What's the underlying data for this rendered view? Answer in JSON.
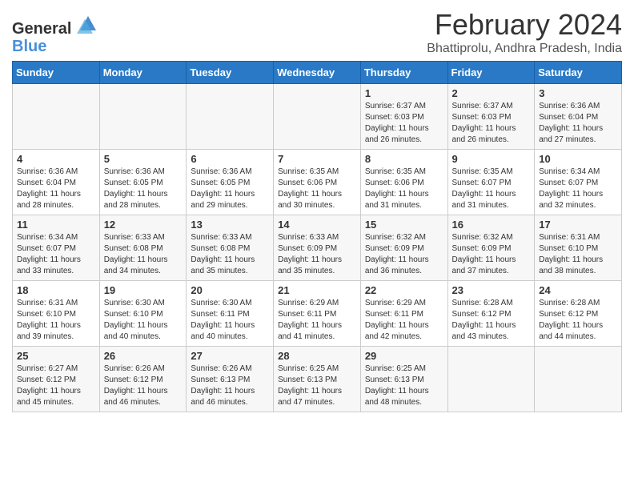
{
  "logo": {
    "text_general": "General",
    "text_blue": "Blue"
  },
  "title": {
    "month_year": "February 2024",
    "location": "Bhattiprolu, Andhra Pradesh, India"
  },
  "headers": [
    "Sunday",
    "Monday",
    "Tuesday",
    "Wednesday",
    "Thursday",
    "Friday",
    "Saturday"
  ],
  "weeks": [
    [
      {
        "day": "",
        "info": ""
      },
      {
        "day": "",
        "info": ""
      },
      {
        "day": "",
        "info": ""
      },
      {
        "day": "",
        "info": ""
      },
      {
        "day": "1",
        "info": "Sunrise: 6:37 AM\nSunset: 6:03 PM\nDaylight: 11 hours\nand 26 minutes."
      },
      {
        "day": "2",
        "info": "Sunrise: 6:37 AM\nSunset: 6:03 PM\nDaylight: 11 hours\nand 26 minutes."
      },
      {
        "day": "3",
        "info": "Sunrise: 6:36 AM\nSunset: 6:04 PM\nDaylight: 11 hours\nand 27 minutes."
      }
    ],
    [
      {
        "day": "4",
        "info": "Sunrise: 6:36 AM\nSunset: 6:04 PM\nDaylight: 11 hours\nand 28 minutes."
      },
      {
        "day": "5",
        "info": "Sunrise: 6:36 AM\nSunset: 6:05 PM\nDaylight: 11 hours\nand 28 minutes."
      },
      {
        "day": "6",
        "info": "Sunrise: 6:36 AM\nSunset: 6:05 PM\nDaylight: 11 hours\nand 29 minutes."
      },
      {
        "day": "7",
        "info": "Sunrise: 6:35 AM\nSunset: 6:06 PM\nDaylight: 11 hours\nand 30 minutes."
      },
      {
        "day": "8",
        "info": "Sunrise: 6:35 AM\nSunset: 6:06 PM\nDaylight: 11 hours\nand 31 minutes."
      },
      {
        "day": "9",
        "info": "Sunrise: 6:35 AM\nSunset: 6:07 PM\nDaylight: 11 hours\nand 31 minutes."
      },
      {
        "day": "10",
        "info": "Sunrise: 6:34 AM\nSunset: 6:07 PM\nDaylight: 11 hours\nand 32 minutes."
      }
    ],
    [
      {
        "day": "11",
        "info": "Sunrise: 6:34 AM\nSunset: 6:07 PM\nDaylight: 11 hours\nand 33 minutes."
      },
      {
        "day": "12",
        "info": "Sunrise: 6:33 AM\nSunset: 6:08 PM\nDaylight: 11 hours\nand 34 minutes."
      },
      {
        "day": "13",
        "info": "Sunrise: 6:33 AM\nSunset: 6:08 PM\nDaylight: 11 hours\nand 35 minutes."
      },
      {
        "day": "14",
        "info": "Sunrise: 6:33 AM\nSunset: 6:09 PM\nDaylight: 11 hours\nand 35 minutes."
      },
      {
        "day": "15",
        "info": "Sunrise: 6:32 AM\nSunset: 6:09 PM\nDaylight: 11 hours\nand 36 minutes."
      },
      {
        "day": "16",
        "info": "Sunrise: 6:32 AM\nSunset: 6:09 PM\nDaylight: 11 hours\nand 37 minutes."
      },
      {
        "day": "17",
        "info": "Sunrise: 6:31 AM\nSunset: 6:10 PM\nDaylight: 11 hours\nand 38 minutes."
      }
    ],
    [
      {
        "day": "18",
        "info": "Sunrise: 6:31 AM\nSunset: 6:10 PM\nDaylight: 11 hours\nand 39 minutes."
      },
      {
        "day": "19",
        "info": "Sunrise: 6:30 AM\nSunset: 6:10 PM\nDaylight: 11 hours\nand 40 minutes."
      },
      {
        "day": "20",
        "info": "Sunrise: 6:30 AM\nSunset: 6:11 PM\nDaylight: 11 hours\nand 40 minutes."
      },
      {
        "day": "21",
        "info": "Sunrise: 6:29 AM\nSunset: 6:11 PM\nDaylight: 11 hours\nand 41 minutes."
      },
      {
        "day": "22",
        "info": "Sunrise: 6:29 AM\nSunset: 6:11 PM\nDaylight: 11 hours\nand 42 minutes."
      },
      {
        "day": "23",
        "info": "Sunrise: 6:28 AM\nSunset: 6:12 PM\nDaylight: 11 hours\nand 43 minutes."
      },
      {
        "day": "24",
        "info": "Sunrise: 6:28 AM\nSunset: 6:12 PM\nDaylight: 11 hours\nand 44 minutes."
      }
    ],
    [
      {
        "day": "25",
        "info": "Sunrise: 6:27 AM\nSunset: 6:12 PM\nDaylight: 11 hours\nand 45 minutes."
      },
      {
        "day": "26",
        "info": "Sunrise: 6:26 AM\nSunset: 6:12 PM\nDaylight: 11 hours\nand 46 minutes."
      },
      {
        "day": "27",
        "info": "Sunrise: 6:26 AM\nSunset: 6:13 PM\nDaylight: 11 hours\nand 46 minutes."
      },
      {
        "day": "28",
        "info": "Sunrise: 6:25 AM\nSunset: 6:13 PM\nDaylight: 11 hours\nand 47 minutes."
      },
      {
        "day": "29",
        "info": "Sunrise: 6:25 AM\nSunset: 6:13 PM\nDaylight: 11 hours\nand 48 minutes."
      },
      {
        "day": "",
        "info": ""
      },
      {
        "day": "",
        "info": ""
      }
    ]
  ]
}
